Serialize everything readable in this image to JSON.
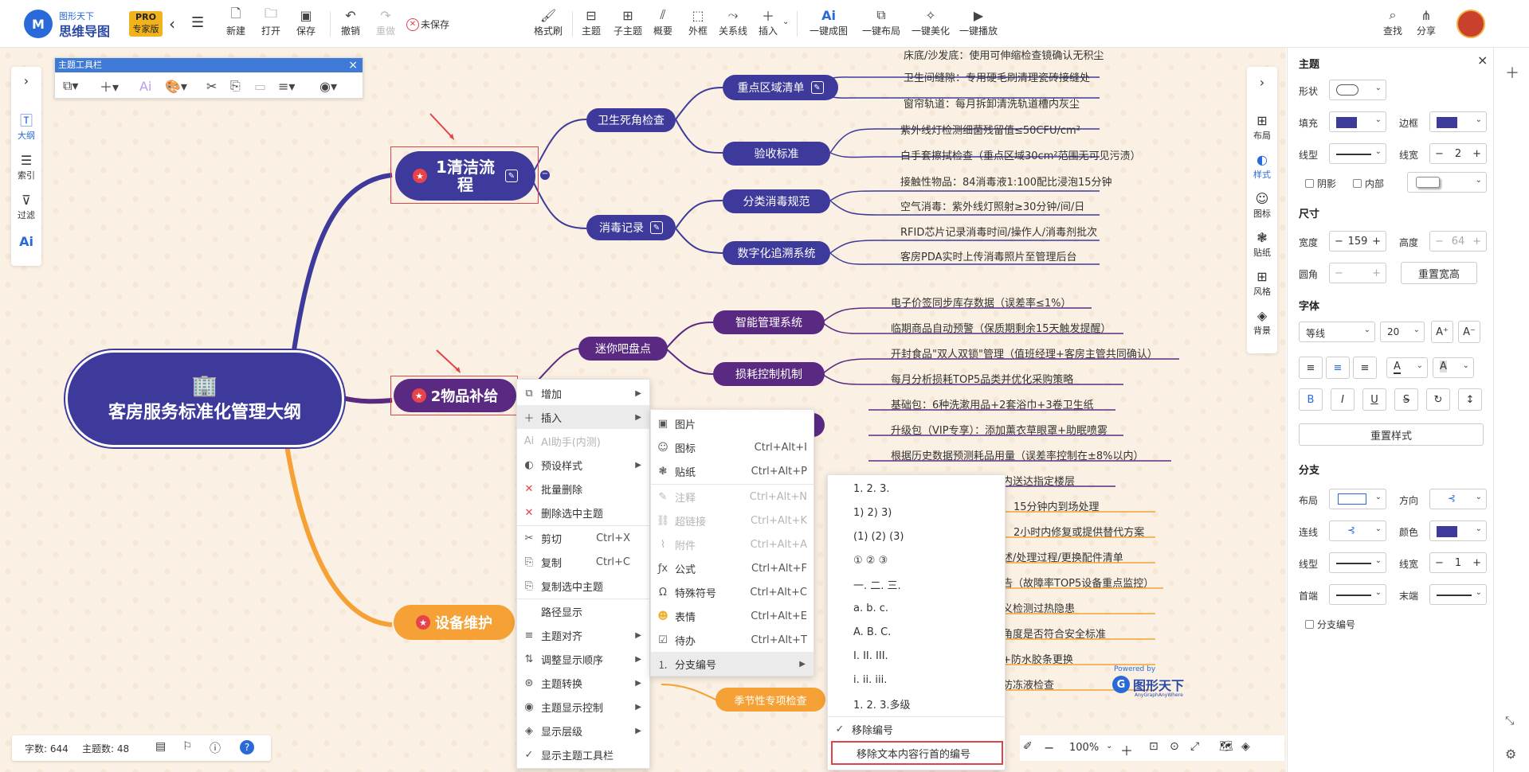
{
  "brand": {
    "name_top": "图形天下",
    "name_main": "思维导图",
    "badge": "PRO",
    "badge_sub": "专家版"
  },
  "toolbar": {
    "new": "新建",
    "open": "打开",
    "save": "保存",
    "undo": "撤销",
    "redo": "重做",
    "unsaved": "未保存",
    "format_brush": "格式刷",
    "topic": "主题",
    "subtopic": "子主题",
    "summary": "概要",
    "frame": "外框",
    "relation": "关系线",
    "insert": "插入",
    "ai_map": "一键成图",
    "ai_layout": "一键布局",
    "ai_beautify": "一键美化",
    "ai_play": "一键播放",
    "find": "查找",
    "share": "分享"
  },
  "left_sidebar": {
    "outline": "大纲",
    "index": "索引",
    "filter": "过滤"
  },
  "float_toolbar": {
    "title": "主题工具栏"
  },
  "mindmap": {
    "root": "客房服务标准化管理大纲",
    "topic1": "1清洁流程",
    "topic1_children": {
      "sanitation": "卫生死角检查",
      "key_areas": "重点区域清单",
      "acceptance": "验收标准",
      "disinfection_record": "消毒记录",
      "category_rules": "分类消毒规范",
      "digital_trace": "数字化追溯系统"
    },
    "topic1_leaves": [
      "床底/沙发底：使用可伸缩检查镜确认无积尘",
      "卫生间缝隙：专用硬毛刷清理瓷砖接缝处",
      "窗帘轨道：每月拆卸清洗轨道槽内灰尘",
      "紫外线灯检测细菌残留值≤50CFU/cm²",
      "白手套擦拭检查（重点区域30cm²范围无可见污渍）",
      "接触性物品：84消毒液1:100配比浸泡15分钟",
      "空气消毒：紫外线灯照射≥30分钟/间/日",
      "RFID芯片记录消毒时间/操作人/消毒剂批次",
      "客房PDA实时上传消毒照片至管理后台"
    ],
    "topic2": "2物品补给",
    "topic2_children": {
      "minibar": "迷你吧盘点",
      "smart_mgmt": "智能管理系统",
      "loss_control": "损耗控制机制"
    },
    "topic2_leaves": [
      "电子价签同步库存数据（误差率≤1%）",
      "临期商品自动预警（保质期剩余15天触发提醒）",
      "开封食品\"双人双锁\"管理（值班经理+客房主管共同确认）",
      "每月分析损耗TOP5品类并优化采购策略",
      "基础包：6种洗漱用品+2套浴巾+3卷卫生纸",
      "升级包（VIP专享）：添加薰衣草眼罩+助眠喷雾",
      "根据历史数据预测耗品用量（误差率控制在±8%以内）",
      "内送达指定楼层"
    ],
    "topic3": "设备维护",
    "topic3_children": {
      "seasonal": "季节性专项检查"
    },
    "topic3_leaves": [
      "15分钟内到场处理",
      "2小时内修复或提供替代方案",
      "述/处理过程/更换配件清单",
      "告（故障率TOP5设备重点监控）",
      "义检测过热隐患",
      "角度是否符合安全标准",
      "+防水胶条更换",
      "防冻液检查"
    ],
    "powered_by": "Powered by",
    "watermark": "图形天下",
    "watermark_sub": "AnyGraphAnyWhere"
  },
  "context_menu": [
    {
      "label": "增加",
      "arrow": true
    },
    {
      "label": "插入",
      "arrow": true
    },
    {
      "label": "AI助手(内测)",
      "disabled": true
    },
    {
      "label": "预设样式",
      "arrow": true
    },
    {
      "label": "批量删除"
    },
    {
      "label": "删除选中主题"
    },
    {
      "label": "剪切",
      "shortcut": "Ctrl+X"
    },
    {
      "label": "复制",
      "shortcut": "Ctrl+C"
    },
    {
      "label": "复制选中主题"
    },
    {
      "label": "路径显示"
    },
    {
      "label": "主题对齐",
      "arrow": true
    },
    {
      "label": "调整显示顺序",
      "arrow": true
    },
    {
      "label": "主题转换",
      "arrow": true
    },
    {
      "label": "主题显示控制",
      "arrow": true
    },
    {
      "label": "显示层级",
      "arrow": true
    },
    {
      "label": "显示主题工具栏"
    }
  ],
  "insert_menu": [
    {
      "label": "图片",
      "shortcut": ""
    },
    {
      "label": "图标",
      "shortcut": "Ctrl+Alt+I"
    },
    {
      "label": "贴纸",
      "shortcut": "Ctrl+Alt+P"
    },
    {
      "label": "注释",
      "shortcut": "Ctrl+Alt+N"
    },
    {
      "label": "超链接",
      "shortcut": "Ctrl+Alt+K"
    },
    {
      "label": "附件",
      "shortcut": "Ctrl+Alt+A"
    },
    {
      "label": "公式",
      "shortcut": "Ctrl+Alt+F"
    },
    {
      "label": "特殊符号",
      "shortcut": "Ctrl+Alt+C"
    },
    {
      "label": "表情",
      "shortcut": "Ctrl+Alt+E"
    },
    {
      "label": "待办",
      "shortcut": "Ctrl+Alt+T"
    },
    {
      "label": "分支编号",
      "shortcut": ""
    }
  ],
  "numbering_menu": [
    "1. 2. 3.",
    "1) 2) 3)",
    "(1) (2) (3)",
    "① ② ③",
    "一. 二. 三.",
    "a. b. c.",
    "A. B. C.",
    "I. II. III.",
    "i. ii. iii.",
    "1. 2. 3.多级",
    "移除编号",
    "移除文本内容行首的编号"
  ],
  "right_dock": {
    "layout": "布局",
    "style": "样式",
    "icon": "图标",
    "sticker": "贴纸",
    "theme_style": "风格",
    "background": "背景"
  },
  "panel": {
    "title": "主题",
    "shape": "形状",
    "fill": "填充",
    "border": "边框",
    "line_type": "线型",
    "line_width": "线宽",
    "line_width_value": "2",
    "shadow": "阴影",
    "inner": "内部",
    "size": "尺寸",
    "width": "宽度",
    "width_value": "159",
    "height": "高度",
    "height_value": "64",
    "radius": "圆角",
    "reset_size": "重置宽高",
    "font": "字体",
    "font_family": "等线",
    "font_size": "20",
    "reset_style": "重置样式",
    "branch": "分支",
    "branch_layout": "布局",
    "direction": "方向",
    "connector": "连线",
    "color": "颜色",
    "branch_line_type": "线型",
    "branch_line_width": "线宽",
    "branch_line_width_value": "1",
    "head": "首端",
    "tail": "末端",
    "branch_numbering": "分支编号"
  },
  "status": {
    "word_count": "字数: 644",
    "topic_count": "主题数: 48",
    "zoom": "100%"
  },
  "colors": {
    "primary": "#3d3a9b",
    "purple": "#5a2a83",
    "orange": "#f5a135",
    "accent": "#2a6ad8",
    "highlight_red": "#e0434a"
  }
}
